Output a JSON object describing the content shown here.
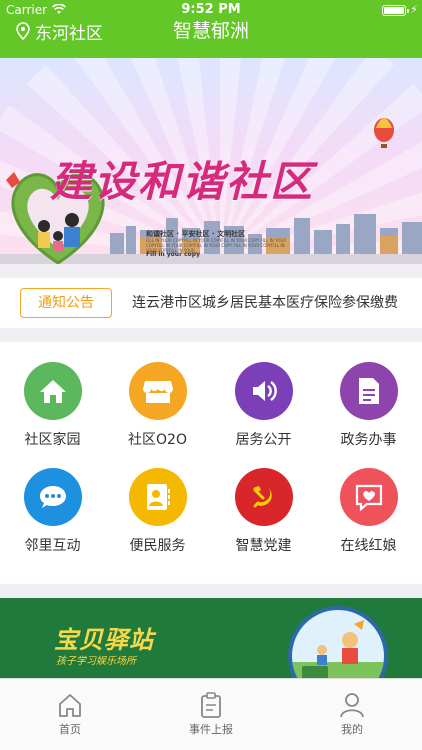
{
  "status_bar": {
    "carrier": "Carrier",
    "time": "9:52 PM"
  },
  "nav": {
    "location": "东河社区",
    "title": "智慧郁洲"
  },
  "banner": {
    "headline": "建设和谐社区",
    "tagline": "和谐社区 · 平安社区 · 文明社区",
    "fineprint": "FILL IN YOUR COPYFILL IN YOUR COPYFILL IN YOUR COPY FILL IN YOUR COPYFILL IN YOUR COPYFILL IN YOUR COPY FILL IN YOUR COPYFILL IN YOUR COPYFILL IN YOUR",
    "fill_text": "Fill in your copy"
  },
  "notice": {
    "badge": "通知公告",
    "text": "连云港市区城乡居民基本医疗保险参保缴费"
  },
  "services": [
    {
      "label": "社区家园",
      "icon": "home-icon",
      "color": "#5cb85c"
    },
    {
      "label": "社区O2O",
      "icon": "store-icon",
      "color": "#f5a623"
    },
    {
      "label": "居务公开",
      "icon": "speaker-icon",
      "color": "#7b3fb8"
    },
    {
      "label": "政务办事",
      "icon": "document-icon",
      "color": "#8e44ad"
    },
    {
      "label": "邻里互动",
      "icon": "chat-icon",
      "color": "#1e90e0"
    },
    {
      "label": "便民服务",
      "icon": "contact-card-icon",
      "color": "#f5b800"
    },
    {
      "label": "智慧党建",
      "icon": "party-emblem-icon",
      "color": "#d9262b"
    },
    {
      "label": "在线红娘",
      "icon": "heart-chat-icon",
      "color": "#f0525c"
    }
  ],
  "promo": {
    "title": "宝贝驿站",
    "subtitle": "孩子学习娱乐场所"
  },
  "tabbar": [
    {
      "label": "首页",
      "icon": "home-tab-icon"
    },
    {
      "label": "事件上报",
      "icon": "report-clipboard-icon"
    },
    {
      "label": "我的",
      "icon": "profile-icon"
    }
  ],
  "colors": {
    "brand_green": "#63c728",
    "notice_orange": "#f6a623",
    "promo_green": "#1f7a3c"
  }
}
